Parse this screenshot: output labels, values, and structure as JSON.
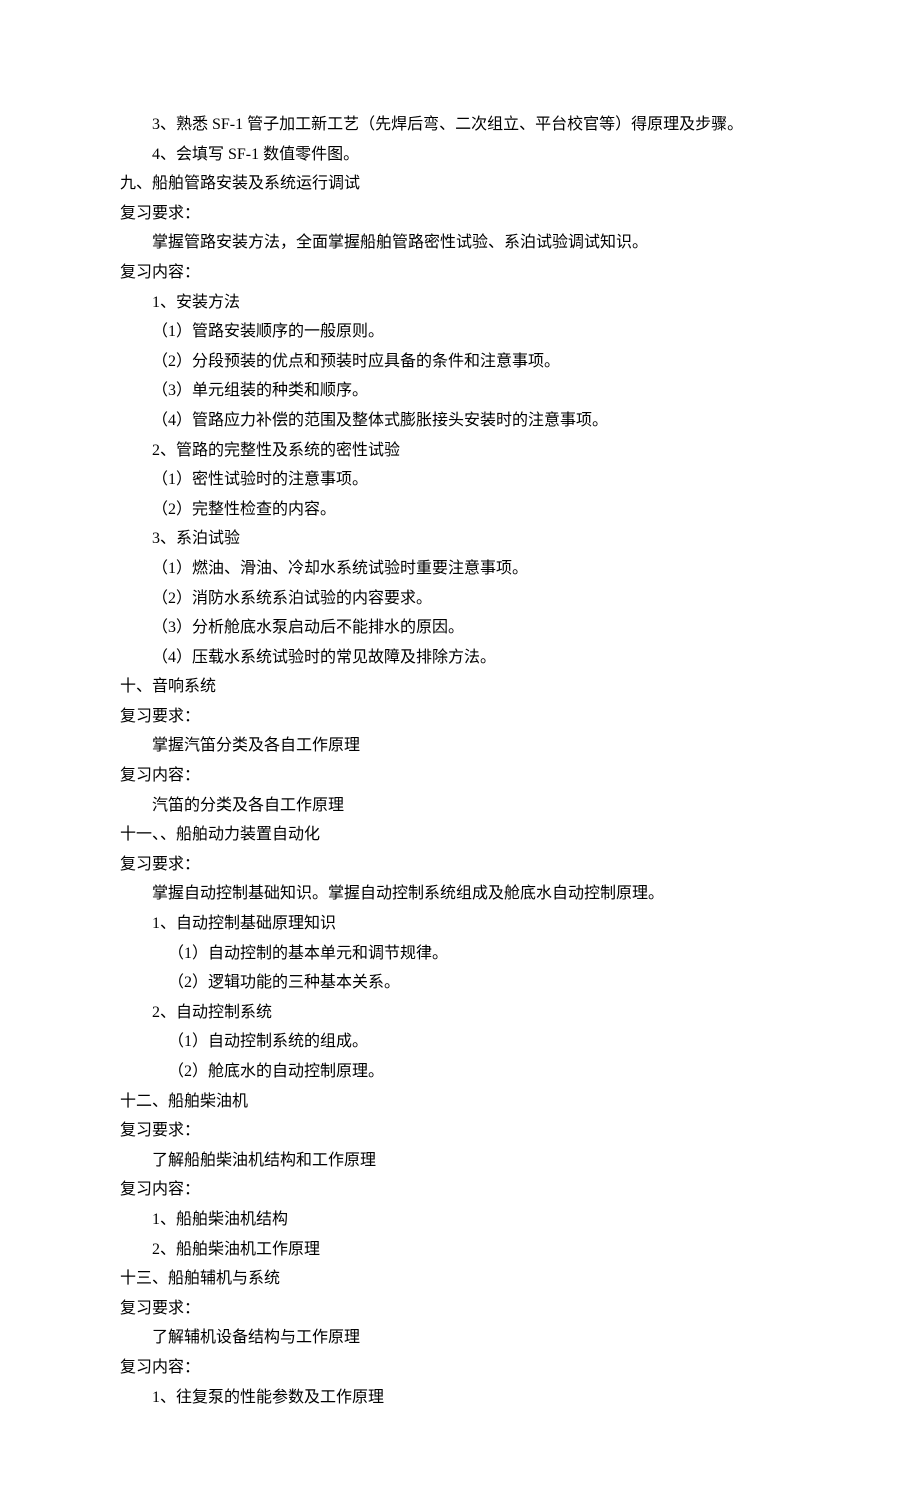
{
  "lines": [
    {
      "indent": 2,
      "text": "3、熟悉 SF-1 管子加工新工艺（先焊后弯、二次组立、平台校官等）得原理及步骤。"
    },
    {
      "indent": 2,
      "text": "4、会填写 SF-1 数值零件图。"
    },
    {
      "indent": 0,
      "text": "九、船舶管路安装及系统运行调试"
    },
    {
      "indent": 0,
      "text": "复习要求："
    },
    {
      "indent": 2,
      "text": "掌握管路安装方法，全面掌握船舶管路密性试验、系泊试验调试知识。"
    },
    {
      "indent": 0,
      "text": "复习内容："
    },
    {
      "indent": 2,
      "text": "1、安装方法"
    },
    {
      "indent": 2,
      "text": "（1）管路安装顺序的一般原则。"
    },
    {
      "indent": 2,
      "text": "（2）分段预装的优点和预装时应具备的条件和注意事项。"
    },
    {
      "indent": 2,
      "text": "（3）单元组装的种类和顺序。"
    },
    {
      "indent": 2,
      "text": "（4）管路应力补偿的范围及整体式膨胀接头安装时的注意事项。"
    },
    {
      "indent": 2,
      "text": "2、管路的完整性及系统的密性试验"
    },
    {
      "indent": 2,
      "text": "（1）密性试验时的注意事项。"
    },
    {
      "indent": 2,
      "text": "（2）完整性检查的内容。"
    },
    {
      "indent": 2,
      "text": "3、系泊试验"
    },
    {
      "indent": 2,
      "text": "（1）燃油、滑油、冷却水系统试验时重要注意事项。"
    },
    {
      "indent": 2,
      "text": "（2）消防水系统系泊试验的内容要求。"
    },
    {
      "indent": 2,
      "text": "（3）分析舱底水泵启动后不能排水的原因。"
    },
    {
      "indent": 2,
      "text": "（4）压载水系统试验时的常见故障及排除方法。"
    },
    {
      "indent": 0,
      "text": "十、音响系统"
    },
    {
      "indent": 0,
      "text": "复习要求："
    },
    {
      "indent": 2,
      "text": "掌握汽笛分类及各自工作原理"
    },
    {
      "indent": 0,
      "text": "复习内容："
    },
    {
      "indent": 2,
      "text": "汽笛的分类及各自工作原理"
    },
    {
      "indent": 0,
      "text": "十一、、船舶动力装置自动化"
    },
    {
      "indent": 0,
      "text": "复习要求："
    },
    {
      "indent": 2,
      "text": "掌握自动控制基础知识。掌握自动控制系统组成及舱底水自动控制原理。"
    },
    {
      "indent": 2,
      "text": "1、自动控制基础原理知识"
    },
    {
      "indent": 3,
      "text": "（1）自动控制的基本单元和调节规律。"
    },
    {
      "indent": 3,
      "text": "（2）逻辑功能的三种基本关系。"
    },
    {
      "indent": 2,
      "text": "2、自动控制系统"
    },
    {
      "indent": 3,
      "text": "（1）自动控制系统的组成。"
    },
    {
      "indent": 3,
      "text": "（2）舱底水的自动控制原理。"
    },
    {
      "indent": 0,
      "text": "十二、船舶柴油机"
    },
    {
      "indent": 0,
      "text": "复习要求："
    },
    {
      "indent": 2,
      "text": "了解船舶柴油机结构和工作原理"
    },
    {
      "indent": 0,
      "text": "复习内容："
    },
    {
      "indent": 2,
      "text": "1、船舶柴油机结构"
    },
    {
      "indent": 2,
      "text": "2、船舶柴油机工作原理"
    },
    {
      "indent": 0,
      "text": "十三、船舶辅机与系统"
    },
    {
      "indent": 0,
      "text": "复习要求："
    },
    {
      "indent": 2,
      "text": "了解辅机设备结构与工作原理"
    },
    {
      "indent": 0,
      "text": "复习内容："
    },
    {
      "indent": 2,
      "text": "1、往复泵的性能参数及工作原理"
    }
  ]
}
